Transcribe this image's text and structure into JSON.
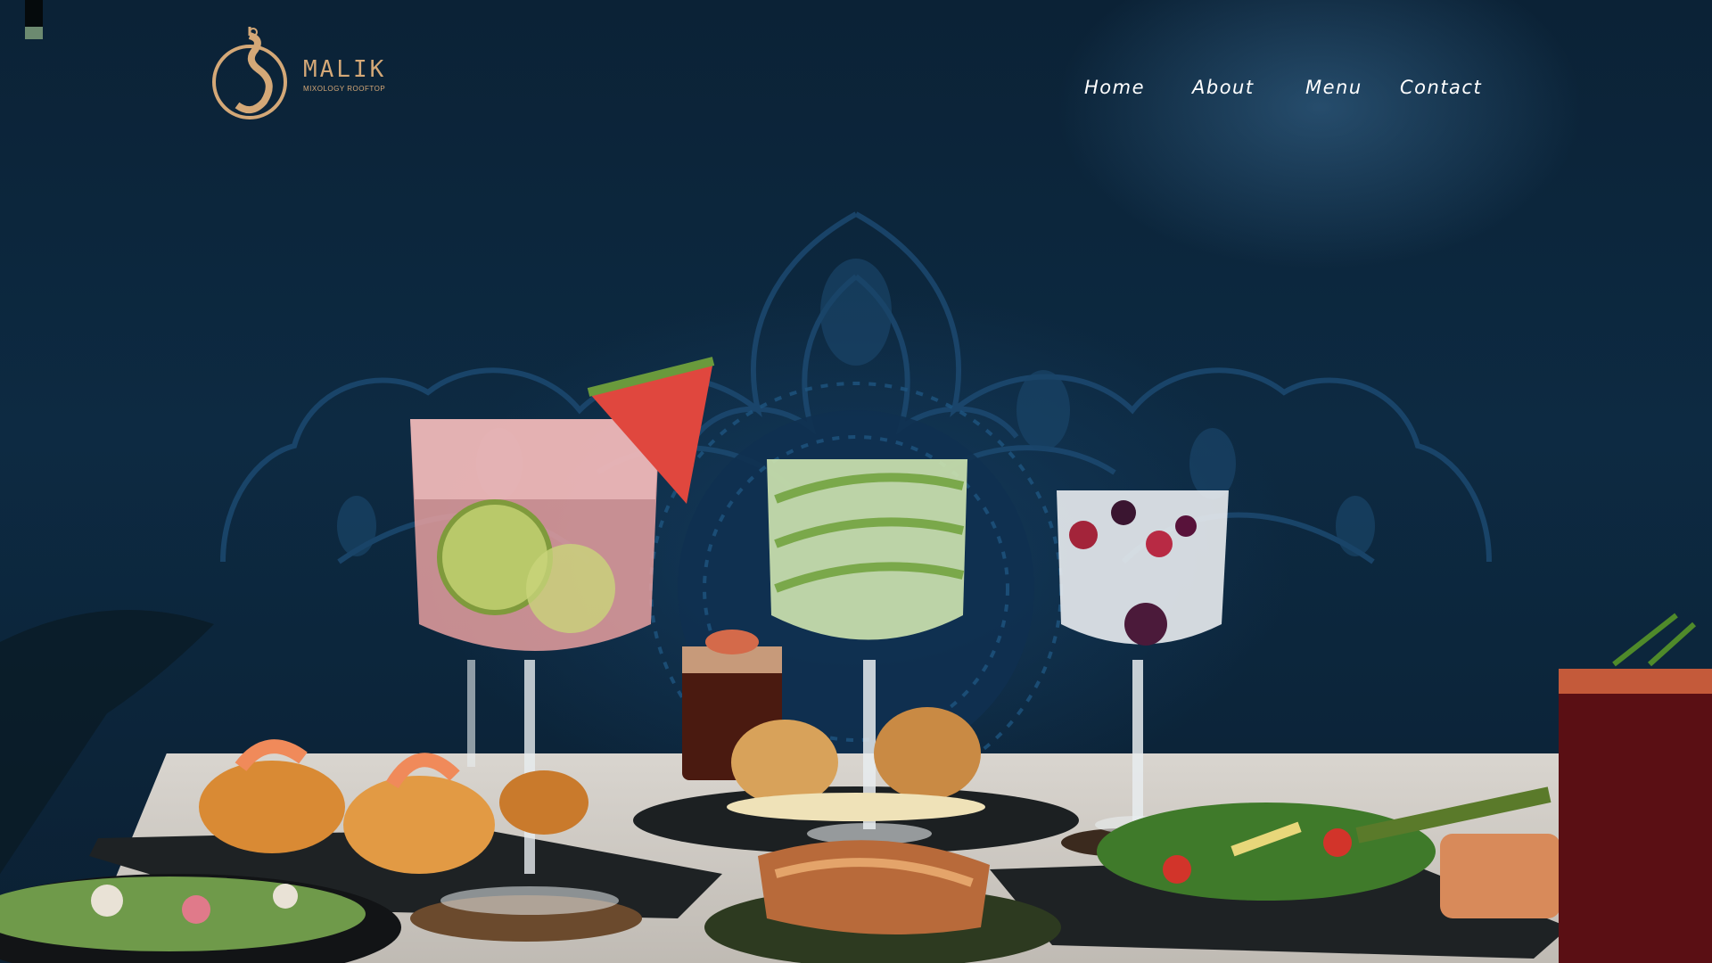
{
  "brand": {
    "name": "MALIK",
    "tagline": "MIXOLOGY ROOFTOP",
    "accent_color": "#d4a877"
  },
  "nav": {
    "items": [
      {
        "label": "Home"
      },
      {
        "label": "About"
      },
      {
        "label": "Menu"
      },
      {
        "label": "Contact"
      }
    ],
    "text_color": "#ffffff"
  },
  "hero": {
    "background_color": "#0c2336",
    "image_description_icon": "cocktails-and-dishes-photo"
  }
}
